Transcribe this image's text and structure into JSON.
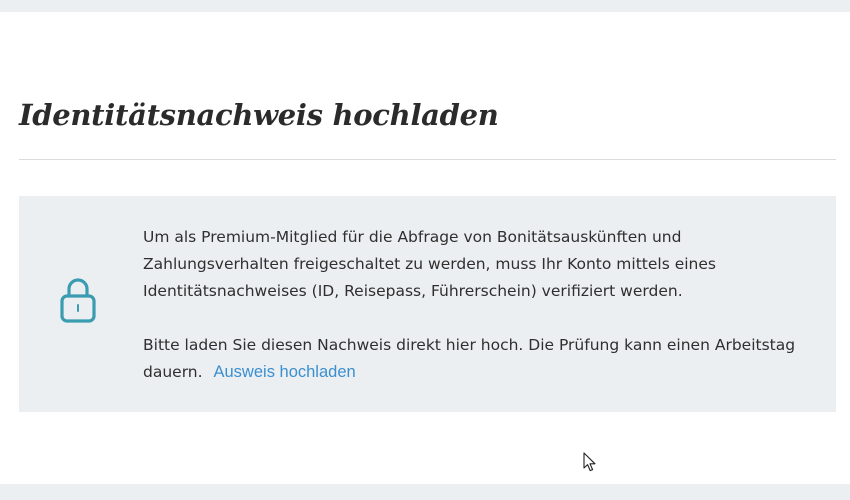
{
  "header": {
    "title": "Identitätsnachweis hochladen"
  },
  "info": {
    "paragraph1": "Um als Premium-Mitglied für die Abfrage von Bonitätsauskünften und Zahlungsverhalten freigeschaltet zu werden, muss Ihr Konto mittels eines Identitätsnachweises (ID, Reisepass, Führerschein) verifiziert werden.",
    "paragraph2": "Bitte laden Sie diesen Nachweis direkt hier hoch. Die Prüfung kann einen Arbeitstag dauern.",
    "upload_link": "Ausweis hochladen",
    "icon": "lock-icon"
  },
  "colors": {
    "page_background": "#eceff1",
    "card_background": "#ffffff",
    "info_box_background": "#eceff1",
    "icon_accent": "#3a9cb0",
    "link": "#3a8fd0",
    "title_text": "#2b2b2b"
  }
}
